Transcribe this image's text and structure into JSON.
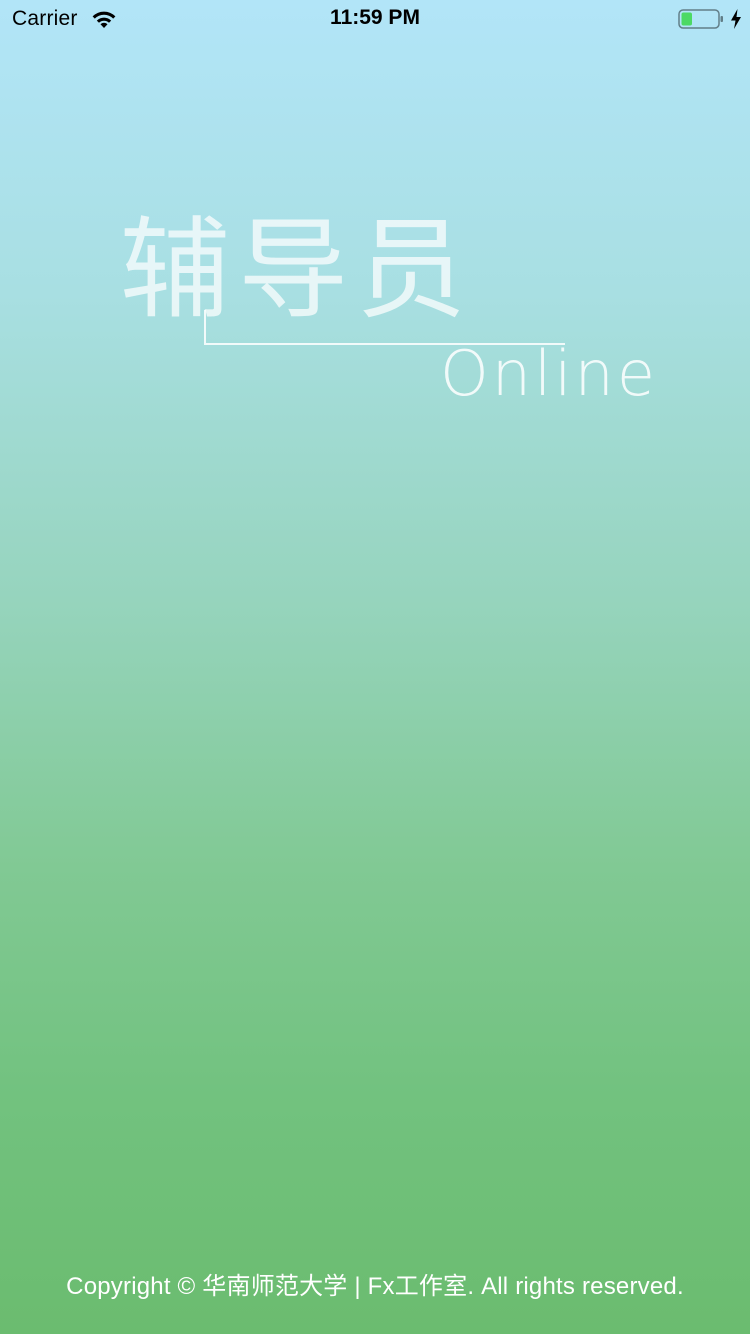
{
  "status_bar": {
    "carrier": "Carrier",
    "time": "11:59 PM",
    "battery_level": 0.3,
    "charging": true,
    "icons": [
      "wifi-icon",
      "battery-icon",
      "charging-bolt-icon"
    ]
  },
  "logo": {
    "chinese_text": "辅导员",
    "english_text": "Online"
  },
  "footer": {
    "copyright": "Copyright © 华南师范大学 | Fx工作室. All rights reserved."
  },
  "colors": {
    "gradient_top": "#b2e5f8",
    "gradient_bottom": "#6bbc6f",
    "battery_fill": "#4cd964"
  }
}
